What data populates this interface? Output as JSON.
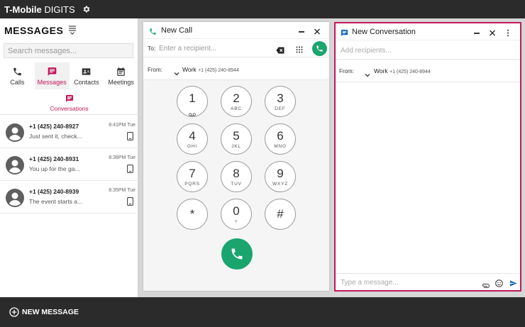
{
  "app": {
    "brand_bold": "T-Mobile",
    "brand_rest": " DIGITS"
  },
  "colors": {
    "accent": "#c2185b",
    "call_green": "#1aa56f",
    "dark_bar": "#2b2b2b"
  },
  "sidebar": {
    "title": "MESSAGES",
    "search_placeholder": "Search messages...",
    "tabs": [
      {
        "label": "Calls",
        "icon": "phone-icon"
      },
      {
        "label": "Messages",
        "icon": "chat-icon",
        "active": true
      },
      {
        "label": "Contacts",
        "icon": "contacts-icon"
      },
      {
        "label": "Meetings",
        "icon": "calendar-icon"
      }
    ],
    "subtab": "Conversations",
    "conversations": [
      {
        "name": "+1 (425) 240-8927",
        "preview": "Just sent it, check...",
        "time": "8:41PM Tue"
      },
      {
        "name": "+1 (425) 240-8931",
        "preview": "You up for the ga...",
        "time": "8:38PM Tue"
      },
      {
        "name": "+1 (425) 240-8939",
        "preview": "The event starts a...",
        "time": "8:35PM Tue"
      }
    ]
  },
  "new_call": {
    "title": "New Call",
    "to_label": "To:",
    "to_placeholder": "Enter a recipient...",
    "from_label": "From:",
    "from_line": "Work",
    "from_number": "+1 (425) 240-8944",
    "keys": [
      {
        "digit": "1",
        "letters": ""
      },
      {
        "digit": "2",
        "letters": "ABC"
      },
      {
        "digit": "3",
        "letters": "DEF"
      },
      {
        "digit": "4",
        "letters": "GHI"
      },
      {
        "digit": "5",
        "letters": "JKL"
      },
      {
        "digit": "6",
        "letters": "MNO"
      },
      {
        "digit": "7",
        "letters": "PQRS"
      },
      {
        "digit": "8",
        "letters": "TUV"
      },
      {
        "digit": "9",
        "letters": "WXYZ"
      },
      {
        "digit": "*",
        "letters": ""
      },
      {
        "digit": "0",
        "letters": "+"
      },
      {
        "digit": "#",
        "letters": ""
      }
    ]
  },
  "new_conversation": {
    "title": "New Conversation",
    "recipients_placeholder": "Add recipients...",
    "from_label": "From:",
    "from_line": "Work",
    "from_number": "+1 (425) 240-8944",
    "message_placeholder": "Type a message..."
  },
  "bottom": {
    "new_message_label": "NEW MESSAGE"
  }
}
